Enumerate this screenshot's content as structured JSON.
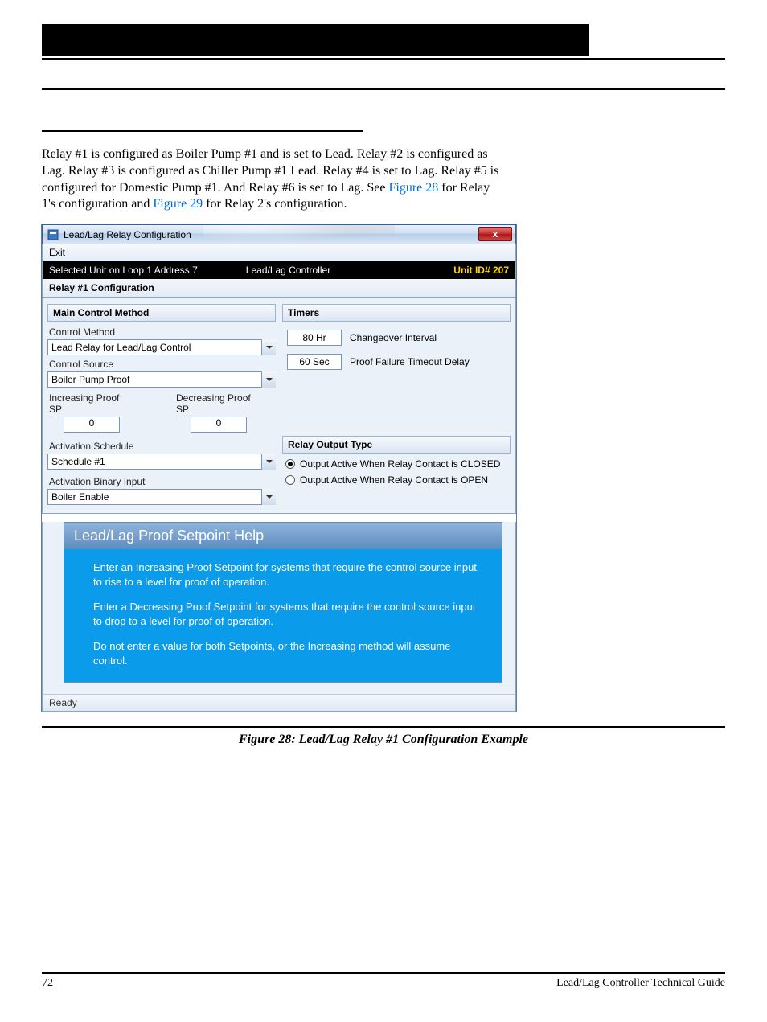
{
  "doc": {
    "page_number": "72",
    "footer_left": "72",
    "footer_right": "Lead/Lag Controller Technical Guide",
    "body_paragraph_prefix": "Relay #1 is configured as Boiler Pump #1 and is set to Lead. Relay #2 is configured as Lag. Relay #3 is configured as Chiller Pump #1 Lead. Relay #4 is set to Lag. Relay #5 is configured for Domestic Pump #1. And Relay #6 is set to Lag. See ",
    "body_link1": "Figure 28",
    "body_mid": " for Relay 1's configuration and ",
    "body_link2": "Figure 29",
    "body_suffix": " for Relay 2's configuration.",
    "fig_caption": "Figure 28: Lead/Lag Relay #1 Configuration Example"
  },
  "win": {
    "title": "Lead/Lag Relay Configuration",
    "close_glyph": "x",
    "menu_exit": "Exit",
    "strip_left": "Selected Unit on Loop 1 Address 7",
    "strip_mid": "Lead/Lag Controller",
    "strip_right": "Unit ID# 207",
    "subtitle": "Relay #1 Configuration",
    "left": {
      "hdr": "Main Control Method",
      "control_method_label": "Control Method",
      "control_method_value": "Lead Relay for Lead/Lag Control",
      "control_source_label": "Control Source",
      "control_source_value": "Boiler Pump Proof",
      "inc_label": "Increasing Proof SP",
      "inc_value": "0",
      "dec_label": "Decreasing Proof SP",
      "dec_value": "0",
      "sched_label": "Activation Schedule",
      "sched_value": "Schedule #1",
      "binary_label": "Activation Binary Input",
      "binary_value": "Boiler Enable"
    },
    "right": {
      "hdr_timers": "Timers",
      "changeover_value": "80 Hr",
      "changeover_label": "Changeover Interval",
      "proof_value": "60 Sec",
      "proof_label": "Proof Failure Timeout Delay",
      "hdr_output": "Relay Output Type",
      "opt_closed": "Output Active When Relay Contact is CLOSED",
      "opt_open": "Output Active When Relay Contact is OPEN"
    },
    "help": {
      "title": "Lead/Lag Proof Setpoint Help",
      "p1": "Enter an Increasing Proof Setpoint for systems that require the control source input to rise to a level for proof of operation.",
      "p2": "Enter a Decreasing Proof Setpoint for systems that require the control source input to drop to a level for proof of operation.",
      "p3": "Do not enter a value for both Setpoints, or the Increasing method will assume control."
    },
    "status": "Ready"
  }
}
